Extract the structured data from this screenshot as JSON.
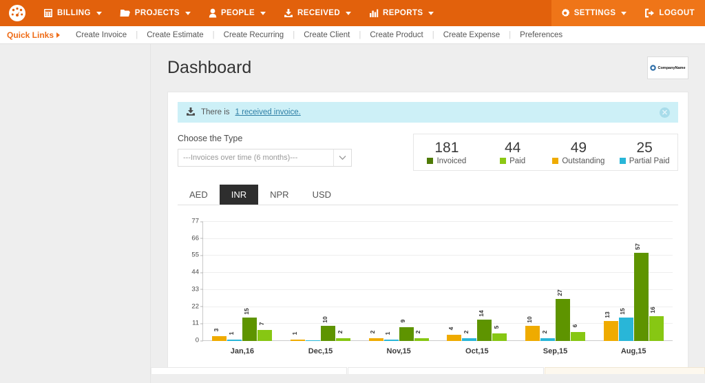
{
  "topnav": {
    "brand_icon": "gauge-icon",
    "items": [
      {
        "label": "BILLING",
        "icon": "calculator-icon",
        "caret": true
      },
      {
        "label": "PROJECTS",
        "icon": "folder-icon",
        "caret": true
      },
      {
        "label": "PEOPLE",
        "icon": "user-icon",
        "caret": true
      },
      {
        "label": "RECEIVED",
        "icon": "download-icon",
        "caret": true
      },
      {
        "label": "REPORTS",
        "icon": "bar-chart-icon",
        "caret": true
      }
    ],
    "right_items": [
      {
        "label": "SETTINGS",
        "icon": "gear-icon",
        "caret": true
      },
      {
        "label": "LOGOUT",
        "icon": "logout-icon",
        "caret": false
      }
    ],
    "bg_color": "#e2610c",
    "right_bg_color": "#ef7518"
  },
  "quicklinks": {
    "title": "Quick Links",
    "links": [
      "Create Invoice",
      "Create Estimate",
      "Create Recurring",
      "Create Client",
      "Create Product",
      "Create Expense",
      "Preferences"
    ],
    "separator": "|"
  },
  "page": {
    "title": "Dashboard",
    "company_logo_text": "CompanyName"
  },
  "alert": {
    "icon": "download-inbox-icon",
    "text": "There is ",
    "link": "1 received invoice.",
    "close_icon": "close-circle-icon",
    "bg_color": "#cdf0f7"
  },
  "controls": {
    "type_label": "Choose the Type",
    "type_selected": "---Invoices over time (6 months)---",
    "type_caret_icon": "chevron-down-icon"
  },
  "stats": [
    {
      "value": "181",
      "label": "Invoiced",
      "color": "#4f7b07"
    },
    {
      "value": "44",
      "label": "Paid",
      "color": "#8cc814"
    },
    {
      "value": "49",
      "label": "Outstanding",
      "color": "#efab00"
    },
    {
      "value": "25",
      "label": "Partial Paid",
      "color": "#29b6d8"
    }
  ],
  "tabs": [
    {
      "label": "AED",
      "active": false
    },
    {
      "label": "INR",
      "active": true
    },
    {
      "label": "NPR",
      "active": false
    },
    {
      "label": "USD",
      "active": false
    }
  ],
  "chart_data": {
    "type": "bar",
    "title": "",
    "xlabel": "",
    "ylabel": "",
    "ylim": [
      0,
      77
    ],
    "yticks": [
      0,
      11,
      22,
      33,
      44,
      55,
      66,
      77
    ],
    "grid": true,
    "legend_position": "top-right",
    "categories": [
      "Jan,16",
      "Dec,15",
      "Nov,15",
      "Oct,15",
      "Sep,15",
      "Aug,15"
    ],
    "series": [
      {
        "name": "Outstanding",
        "color": "#efab00",
        "values": [
          3,
          1,
          2,
          4,
          10,
          13
        ]
      },
      {
        "name": "Partial Paid",
        "color": "#29b6d8",
        "values": [
          1,
          0,
          1,
          2,
          2,
          15
        ]
      },
      {
        "name": "Invoiced",
        "color": "#5e9400",
        "values": [
          15,
          10,
          9,
          14,
          27,
          57
        ]
      },
      {
        "name": "Paid",
        "color": "#87c713",
        "values": [
          7,
          2,
          2,
          5,
          6,
          16
        ]
      }
    ]
  }
}
